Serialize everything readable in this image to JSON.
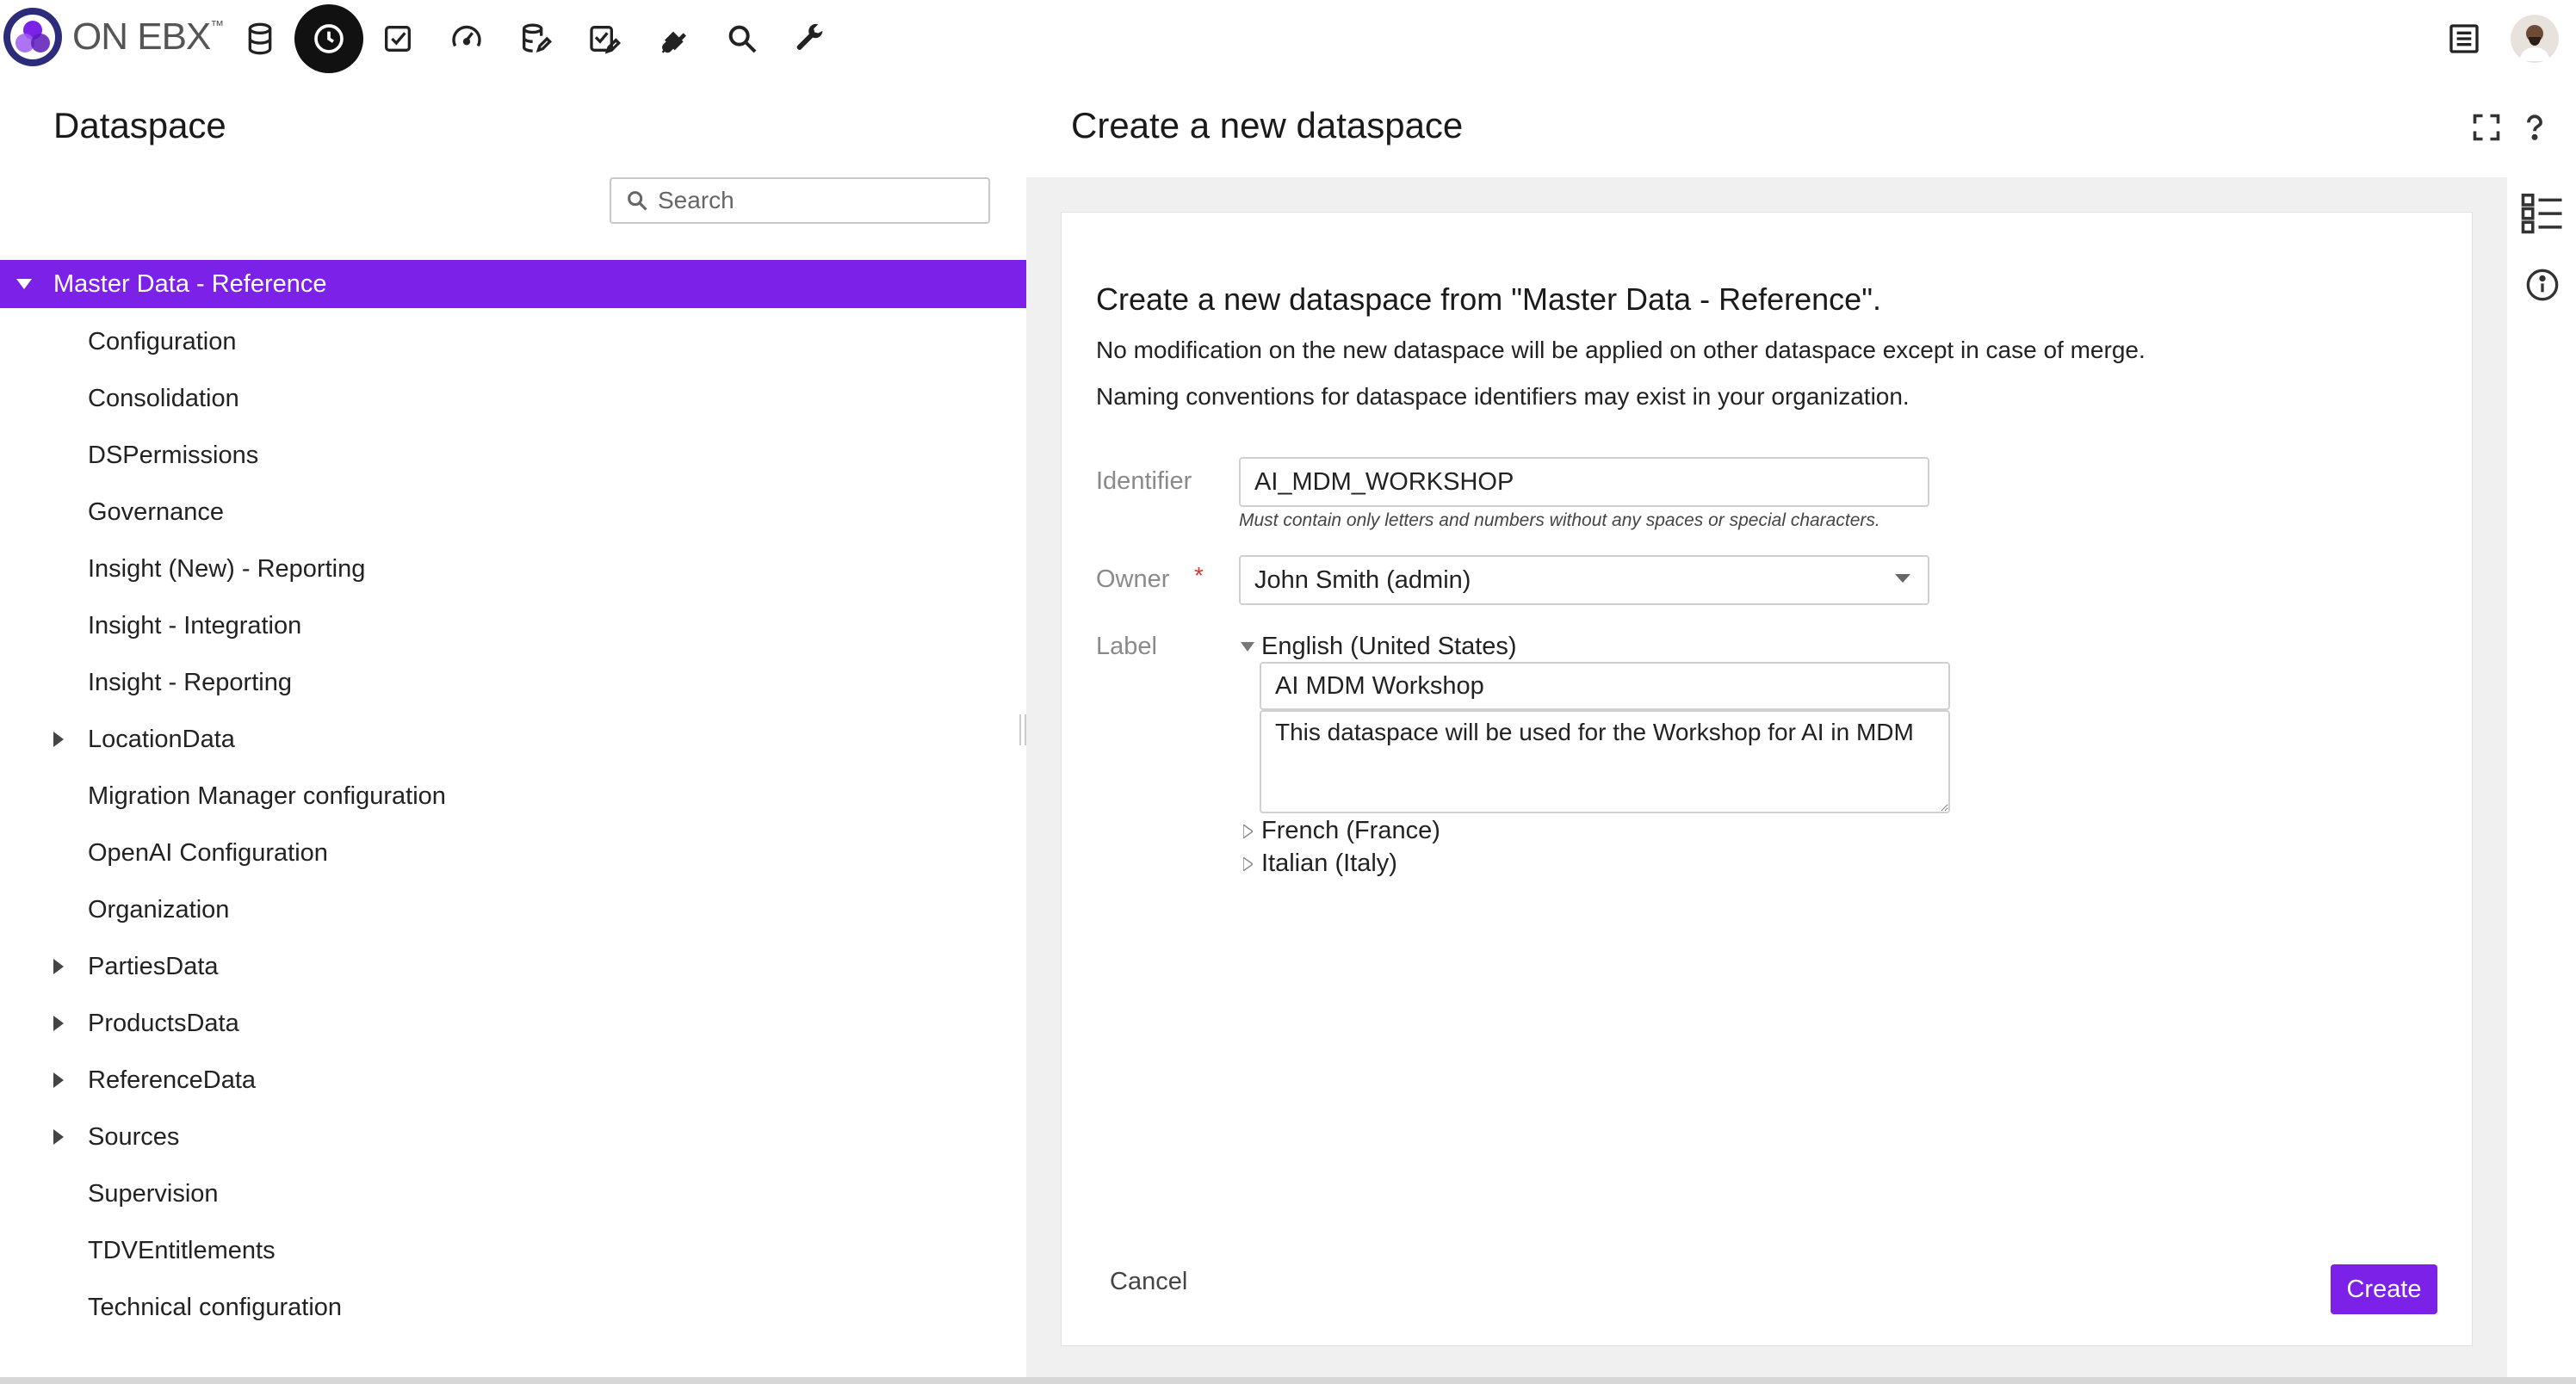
{
  "app": {
    "logo_text": "ON EBX",
    "logo_tm": "™",
    "nav": [
      {
        "name": "dataspaces-nav",
        "icon": "database-icon"
      },
      {
        "name": "history-nav",
        "icon": "clock-icon",
        "active": true
      },
      {
        "name": "tasks-nav",
        "icon": "checkbox-icon"
      },
      {
        "name": "dashboard-nav",
        "icon": "gauge-icon"
      },
      {
        "name": "data-models-nav",
        "icon": "database-edit-icon"
      },
      {
        "name": "workflow-nav",
        "icon": "checklist-edit-icon"
      },
      {
        "name": "integration-nav",
        "icon": "plug-icon"
      },
      {
        "name": "search-nav",
        "icon": "search-icon"
      },
      {
        "name": "administration-nav",
        "icon": "wrench-icon"
      }
    ],
    "accent_color": "#7b21e8"
  },
  "left": {
    "title": "Dataspace",
    "search_placeholder": "Search",
    "tree": [
      {
        "label": "Master Data - Reference",
        "expanded": true,
        "selected": true,
        "level": 0
      },
      {
        "label": "Configuration",
        "level": 1
      },
      {
        "label": "Consolidation",
        "level": 1
      },
      {
        "label": "DSPermissions",
        "level": 1
      },
      {
        "label": "Governance",
        "level": 1
      },
      {
        "label": "Insight (New) - Reporting",
        "level": 1
      },
      {
        "label": "Insight - Integration",
        "level": 1
      },
      {
        "label": "Insight - Reporting",
        "level": 1
      },
      {
        "label": "LocationData",
        "level": 1,
        "expandable": true
      },
      {
        "label": "Migration Manager configuration",
        "level": 1
      },
      {
        "label": "OpenAI Configuration",
        "level": 1
      },
      {
        "label": "Organization",
        "level": 1
      },
      {
        "label": "PartiesData",
        "level": 1,
        "expandable": true
      },
      {
        "label": "ProductsData",
        "level": 1,
        "expandable": true
      },
      {
        "label": "ReferenceData",
        "level": 1,
        "expandable": true
      },
      {
        "label": "Sources",
        "level": 1,
        "expandable": true
      },
      {
        "label": "Supervision",
        "level": 1
      },
      {
        "label": "TDVEntitlements",
        "level": 1
      },
      {
        "label": "Technical configuration",
        "level": 1
      }
    ]
  },
  "right": {
    "title": "Create a new dataspace",
    "form": {
      "heading": "Create a new dataspace from \"Master Data - Reference\".",
      "info1": "No modification on the new dataspace will be applied on other dataspace except in case of merge.",
      "info2": "Naming conventions for dataspace identifiers may exist in your organization.",
      "identifier_label": "Identifier",
      "identifier_value": "AI_MDM_WORKSHOP",
      "identifier_hint": "Must contain only letters and numbers without any spaces or special characters.",
      "owner_label": "Owner",
      "owner_required": "*",
      "owner_value": "John Smith (admin)",
      "label_label": "Label",
      "languages": [
        {
          "name": "English (United States)",
          "expanded": true
        },
        {
          "name": "French (France)",
          "expanded": false
        },
        {
          "name": "Italian (Italy)",
          "expanded": false
        }
      ],
      "label_value": "AI MDM Workshop",
      "description_value": "This dataspace will be used for the Workshop for AI in MDM",
      "cancel_label": "Cancel",
      "create_label": "Create"
    }
  }
}
